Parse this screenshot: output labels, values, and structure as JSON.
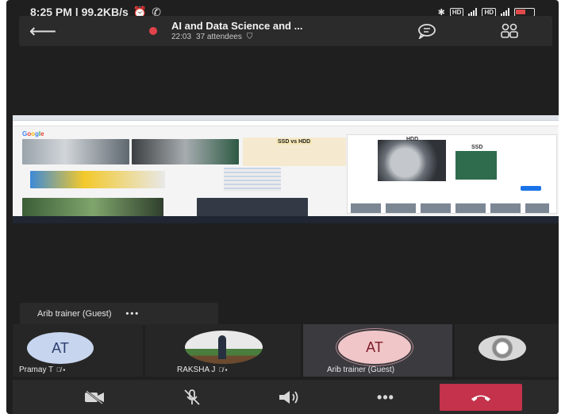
{
  "status_bar": {
    "time_speed": "8:25 PM | 99.2KB/s",
    "badge_1": "HD",
    "badge_2": "HD"
  },
  "call_header": {
    "title": "AI and Data Science and ...",
    "duration": "22:03",
    "attendees": "37 attendees",
    "record_color": "#e0434a"
  },
  "shared_screen": {
    "search_word": "SSD vs HDD",
    "logo_letters": [
      "G",
      "o",
      "o",
      "g",
      "l",
      "e"
    ],
    "hdd_label": "HDD",
    "ssd_label": "SSD"
  },
  "presenter": {
    "name": "Arib trainer (Guest)",
    "more": "•••"
  },
  "participants": [
    {
      "initials": "AT",
      "name": "Pramay T",
      "avatar_color": "#c7d5ee"
    },
    {
      "initials": "",
      "name": "RAKSHA J",
      "avatar_color": "#e9e9e9"
    },
    {
      "initials": "AT",
      "name": "Arib trainer (Guest)",
      "avatar_color": "#f1c6c8"
    },
    {
      "initials": "",
      "name": "",
      "avatar_color": "#d8d8d8"
    }
  ],
  "controls": {
    "camera": "camera-off-icon",
    "mic": "mic-off-icon",
    "speaker": "speaker-icon",
    "more": "•••",
    "hangup_color": "#c4324b"
  }
}
